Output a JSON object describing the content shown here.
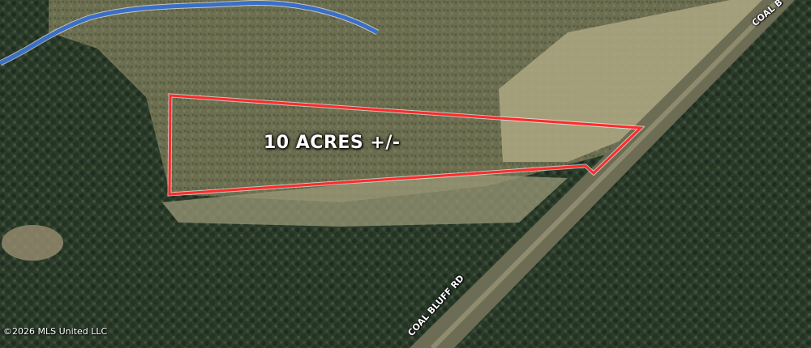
{
  "map": {
    "parcel_label": "10 ACRES +/-",
    "road_labels": [
      "COAL BLUFF RD",
      "COAL B"
    ],
    "copyright": "©2026 MLS United LLC",
    "colors": {
      "boundary": "#ff2a2a",
      "creek": "#3a6fc8",
      "forest": "#2a3a28",
      "clearing": "#8d8b66",
      "field": "#aba47f"
    }
  }
}
